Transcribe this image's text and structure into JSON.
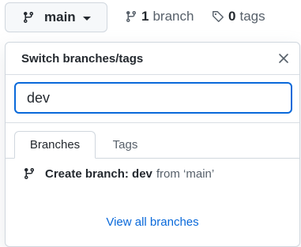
{
  "branch_selector": {
    "current_branch": "main",
    "icon": "git-branch-icon"
  },
  "repo_meta": {
    "branches": {
      "count": "1",
      "label": "branch",
      "icon": "git-branch-icon"
    },
    "tags": {
      "count": "0",
      "label": "tags",
      "icon": "tag-icon"
    }
  },
  "dropdown": {
    "title": "Switch branches/tags",
    "close_icon": "close-icon",
    "search": {
      "value": "dev",
      "placeholder": ""
    },
    "tabs": [
      {
        "label": "Branches",
        "active": true
      },
      {
        "label": "Tags",
        "active": false
      }
    ],
    "create_branch": {
      "icon": "git-branch-icon",
      "label": "Create branch: dev",
      "from_text": "from ‘main’"
    },
    "footer_link": "View all branches"
  },
  "colors": {
    "accent": "#0969da",
    "border": "#d0d7de",
    "text": "#24292f",
    "muted": "#57606a"
  }
}
